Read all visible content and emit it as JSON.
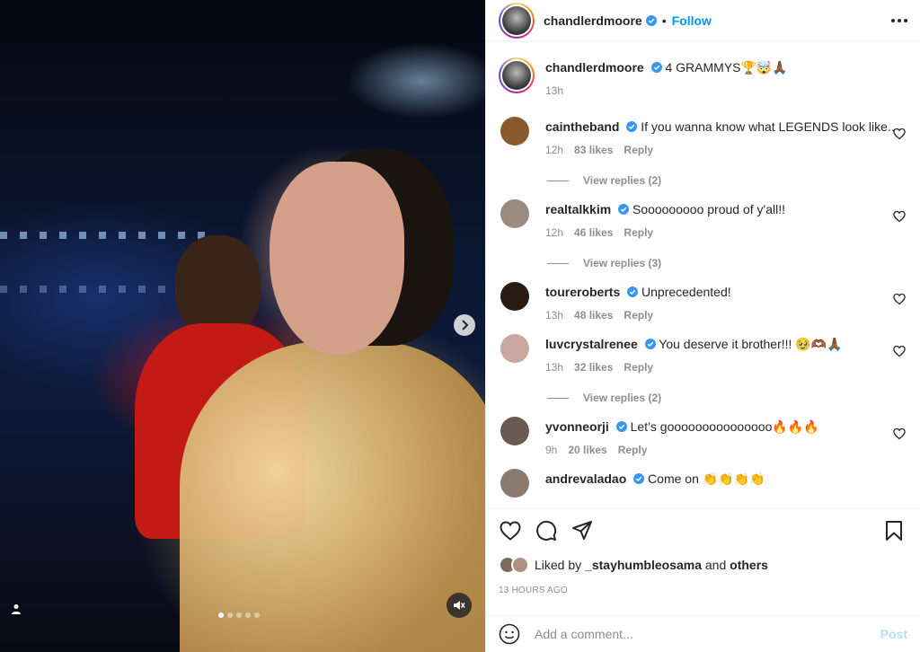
{
  "post": {
    "author": "chandlerdmoore",
    "follow_label": "Follow",
    "separator": "•"
  },
  "caption": {
    "username": "chandlerdmoore",
    "text": "4 GRAMMYS🏆🤯🙏🏾",
    "time": "13h"
  },
  "comments": [
    {
      "username": "caintheband",
      "text": "If you wanna know what LEGENDS look like..",
      "time": "12h",
      "likes": "83 likes",
      "reply": "Reply",
      "view_replies": "View replies (2)",
      "avatar_color": "#8a5a2e"
    },
    {
      "username": "realtalkkim",
      "text": "Sooooooooo proud of y'all!!",
      "time": "12h",
      "likes": "46 likes",
      "reply": "Reply",
      "view_replies": "View replies (3)",
      "avatar_color": "#9a8a80"
    },
    {
      "username": "toureroberts",
      "text": "Unprecedented!",
      "time": "13h",
      "likes": "48 likes",
      "reply": "Reply",
      "view_replies": null,
      "avatar_color": "#2a1a14"
    },
    {
      "username": "luvcrystalrenee",
      "text": "You deserve it brother!!! 🥹🫶🏾🙏🏾",
      "time": "13h",
      "likes": "32 likes",
      "reply": "Reply",
      "view_replies": "View replies (2)",
      "avatar_color": "#c9a6a0"
    },
    {
      "username": "yvonneorji",
      "text": "Let’s gooooooooooooooo🔥🔥🔥",
      "time": "9h",
      "likes": "20 likes",
      "reply": "Reply",
      "view_replies": null,
      "avatar_color": "#6a5a52"
    },
    {
      "username": "andrevaladao",
      "text": "Come on 👏👏👏👏",
      "time": "",
      "likes": "",
      "reply": "",
      "view_replies": null,
      "avatar_color": "#8a7a70"
    }
  ],
  "likes": {
    "prefix": "Liked by",
    "user": "_stayhumbleosama",
    "and": "and",
    "others": "others"
  },
  "time_ago": "13 HOURS AGO",
  "add_comment": {
    "placeholder": "Add a comment...",
    "post_label": "Post"
  },
  "carousel": {
    "slides": 5,
    "active": 0
  },
  "colors": {
    "accent": "#0095f6",
    "muted": "#8e8e8e",
    "verified": "#3897f0",
    "post_disabled": "#b2dffc"
  },
  "icons": [
    "chevron-right-icon",
    "user-tag-icon",
    "mute-icon",
    "more-icon",
    "verified-icon",
    "heart-icon",
    "comment-icon",
    "share-icon",
    "bookmark-icon",
    "emoji-icon"
  ]
}
